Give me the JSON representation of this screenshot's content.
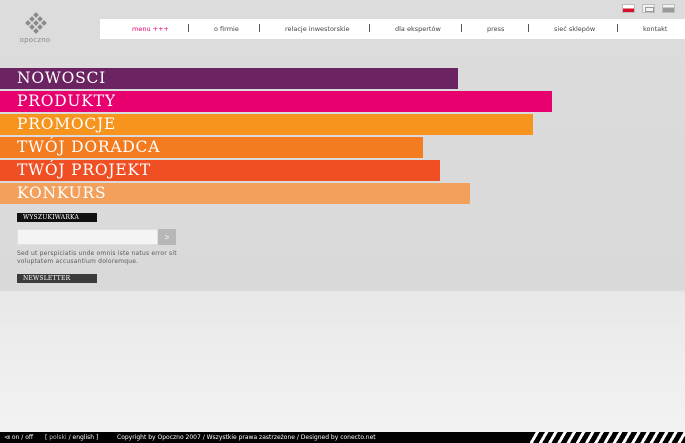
{
  "logo": {
    "text": "opoczno"
  },
  "flags": [
    "polish-flag-icon",
    "sitemap-icon",
    "gray-flag-icon"
  ],
  "topnav": {
    "items": [
      {
        "label": "menu +++",
        "active": true
      },
      {
        "label": "o firmie"
      },
      {
        "label": "relacje inwestorskie"
      },
      {
        "label": "dla ekspertów"
      },
      {
        "label": "press"
      },
      {
        "label": "sieć sklepów"
      },
      {
        "label": "kontakt"
      }
    ]
  },
  "menu": {
    "items": [
      {
        "label": "NOWOSCI",
        "color": "#6b2461"
      },
      {
        "label": "PRODUKTY",
        "color": "#e8006f"
      },
      {
        "label": "PROMOCJE",
        "color": "#f7941d"
      },
      {
        "label": "TWÓJ DORADCA",
        "color": "#f47c20"
      },
      {
        "label": "TWÓJ PROJEKT",
        "color": "#f04e23"
      },
      {
        "label": "KONKURS",
        "color": "#f3a05c"
      }
    ]
  },
  "search": {
    "label": "WYSZUKIWARKA",
    "placeholder": "",
    "button": ">",
    "description": "Sed ut perspiciatis unde omnis iste natus error sit voluptatem accusantium doloremque."
  },
  "newsletter": {
    "label": "NEWSLETTER"
  },
  "footer": {
    "onoff": "on / off",
    "lang_open": "[ ",
    "lang_polski": "polski",
    "lang_sep": " / ",
    "lang_english": "english",
    "lang_close": " ]",
    "copyright": "Copyright by Opoczno 2007 / Wszystkie prawa zastrzeżone / Designed by conecto.net"
  }
}
